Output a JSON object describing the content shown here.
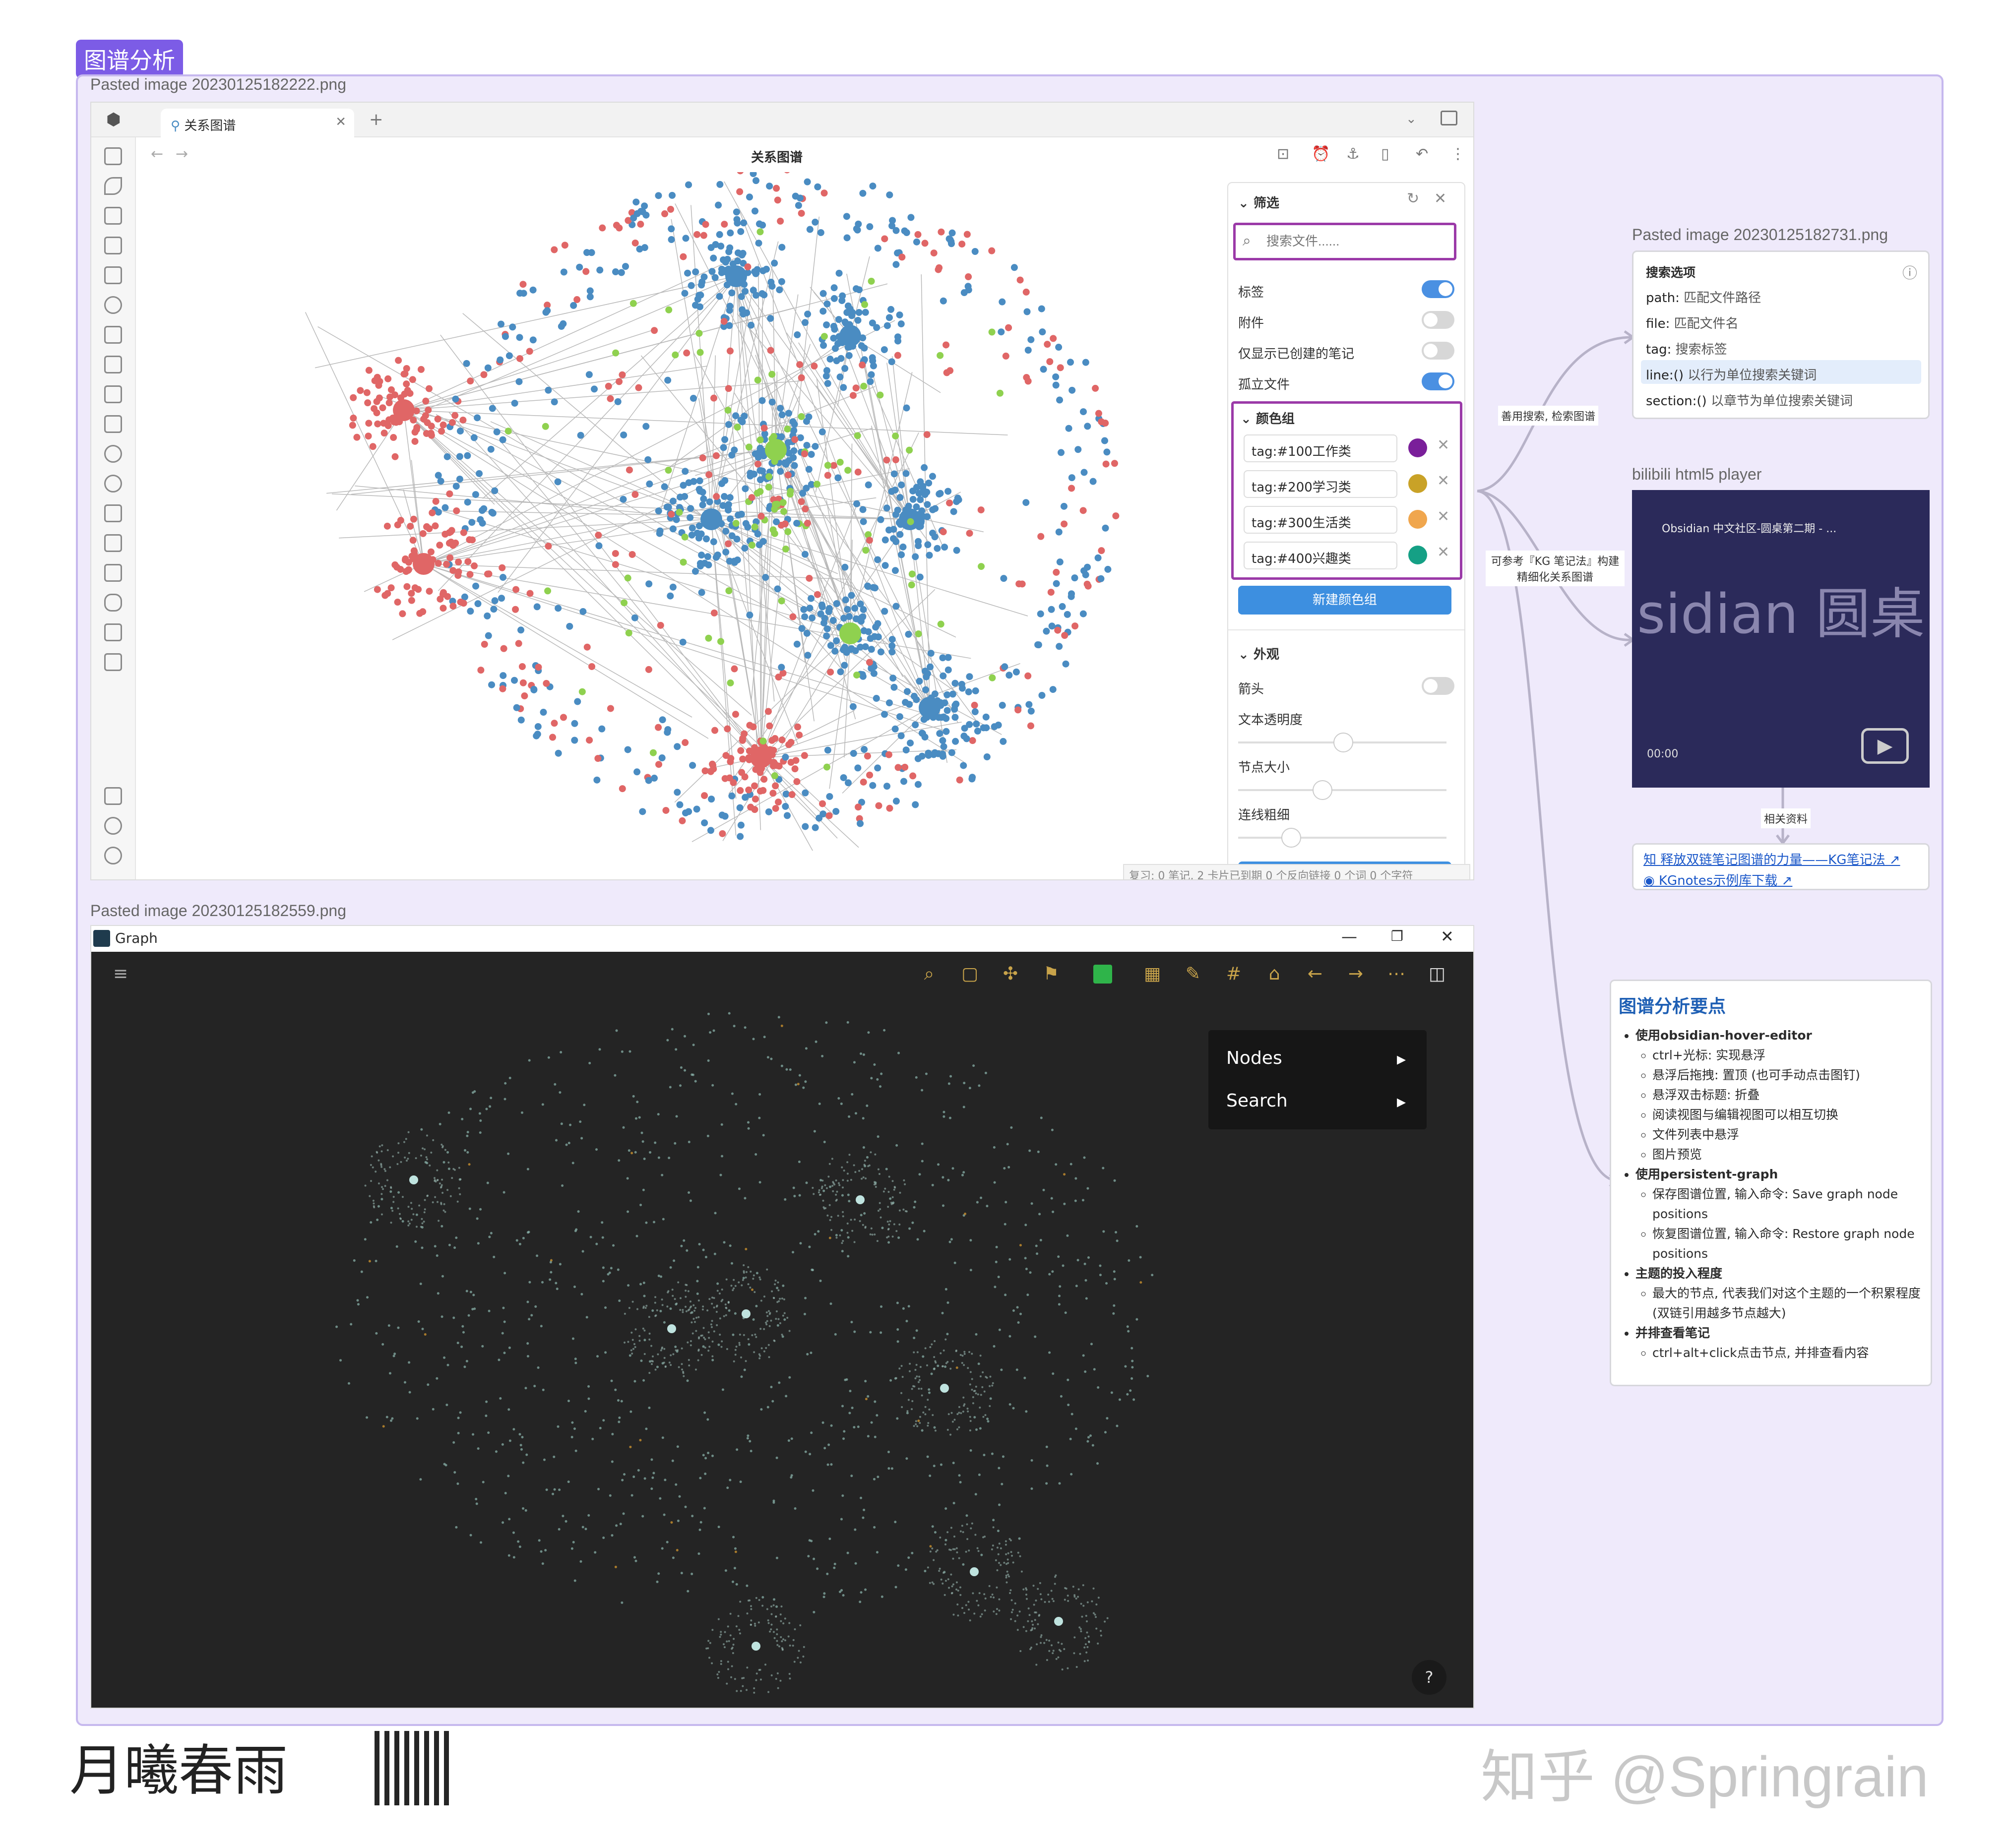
{
  "group_label": "图谱分析",
  "images": {
    "top_caption": "Pasted image 20230125182222.png",
    "bottom_caption": "Pasted image 20230125182559.png",
    "search_caption": "Pasted image 20230125182731.png",
    "video_caption": "bilibili html5 player"
  },
  "obsidian": {
    "tab_title": "关系图谱",
    "view_title": "关系图谱",
    "filter": {
      "title": "筛选",
      "search_placeholder": "搜索文件......",
      "toggles": [
        {
          "label": "标签",
          "on": true
        },
        {
          "label": "附件",
          "on": false
        },
        {
          "label": "仅显示已创建的笔记",
          "on": false
        },
        {
          "label": "孤立文件",
          "on": true
        }
      ]
    },
    "color_groups": {
      "title": "颜色组",
      "items": [
        {
          "query": "tag:#100工作类",
          "color": "#7a1f9a"
        },
        {
          "query": "tag:#200学习类",
          "color": "#c9a227"
        },
        {
          "query": "tag:#300生活类",
          "color": "#f0a64d"
        },
        {
          "query": "tag:#400兴趣类",
          "color": "#15a085"
        }
      ],
      "new_button": "新建颜色组"
    },
    "appearance": {
      "title": "外观",
      "arrow_label": "箭头",
      "arrow_on": false,
      "sliders": [
        {
          "label": "文本透明度",
          "value": 0.5
        },
        {
          "label": "节点大小",
          "value": 0.4
        },
        {
          "label": "连线粗细",
          "value": 0.25
        }
      ]
    },
    "status": "复习: 0 笔记, 2 卡片已到期   0 个反向链接   0 个词   0 个字符",
    "colors": {
      "blue": "#4a8cc2",
      "red": "#e06666",
      "green": "#8fd14f"
    }
  },
  "dark_graph": {
    "title": "Graph",
    "menu": [
      "Nodes",
      "Search"
    ],
    "help": "?"
  },
  "search_options": {
    "title": "搜索选项",
    "options": [
      {
        "key": "path:",
        "desc": "匹配文件路径"
      },
      {
        "key": "file:",
        "desc": "匹配文件名"
      },
      {
        "key": "tag:",
        "desc": "搜索标签"
      },
      {
        "key": "line:()",
        "desc": "以行为单位搜索关键词"
      },
      {
        "key": "section:()",
        "desc": "以章节为单位搜索关键词"
      }
    ]
  },
  "video": {
    "channel": "Obsidian 中文社区-圆桌第二期 - ...",
    "big_text": "sidian 圆桌",
    "time": "00:00"
  },
  "edges": {
    "label1": "善用搜索, 检索图谱",
    "label2": "可参考『KG 笔记法』构建精细化关系图谱",
    "label3": "相关资料"
  },
  "links": [
    "释放双链笔记图谱的力量——KG笔记法",
    "KGnotes示例库下载"
  ],
  "summary": {
    "title": "图谱分析要点",
    "sections": [
      {
        "heading": "使用obsidian-hover-editor",
        "items": [
          "ctrl+光标: 实现悬浮",
          "悬浮后拖拽: 置顶 (也可手动点击图钉)",
          "悬浮双击标题: 折叠",
          "阅读视图与编辑视图可以相互切换",
          "文件列表中悬浮",
          "图片预览"
        ]
      },
      {
        "heading": "使用persistent-graph",
        "items": [
          "保存图谱位置, 输入命令: Save graph node positions",
          "恢复图谱位置, 输入命令: Restore graph node positions"
        ]
      },
      {
        "heading": "主题的投入程度",
        "items": [
          "最大的节点, 代表我们对这个主题的一个积累程度 (双链引用越多节点越大)"
        ]
      },
      {
        "heading": "并排查看笔记",
        "items": [
          "ctrl+alt+click点击节点, 并排查看内容"
        ]
      }
    ]
  },
  "watermark": {
    "left": "月曦春雨",
    "right": "知乎 @Springrain"
  }
}
